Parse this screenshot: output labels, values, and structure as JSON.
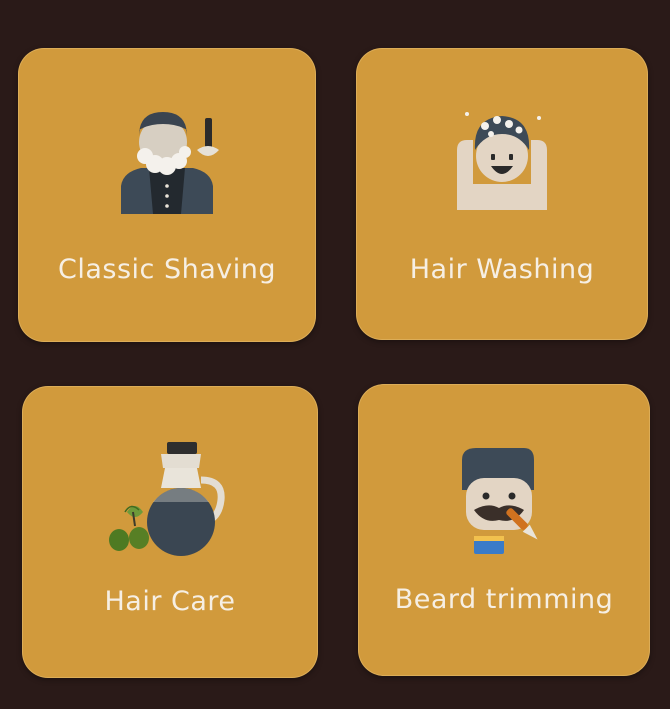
{
  "services": [
    {
      "label": "Classic Shaving",
      "icon": "barber-shaving-icon"
    },
    {
      "label": "Hair Washing",
      "icon": "hair-washing-icon"
    },
    {
      "label": "Hair Care",
      "icon": "oil-bottle-icon"
    },
    {
      "label": "Beard trimming",
      "icon": "beard-trimming-icon"
    }
  ]
}
